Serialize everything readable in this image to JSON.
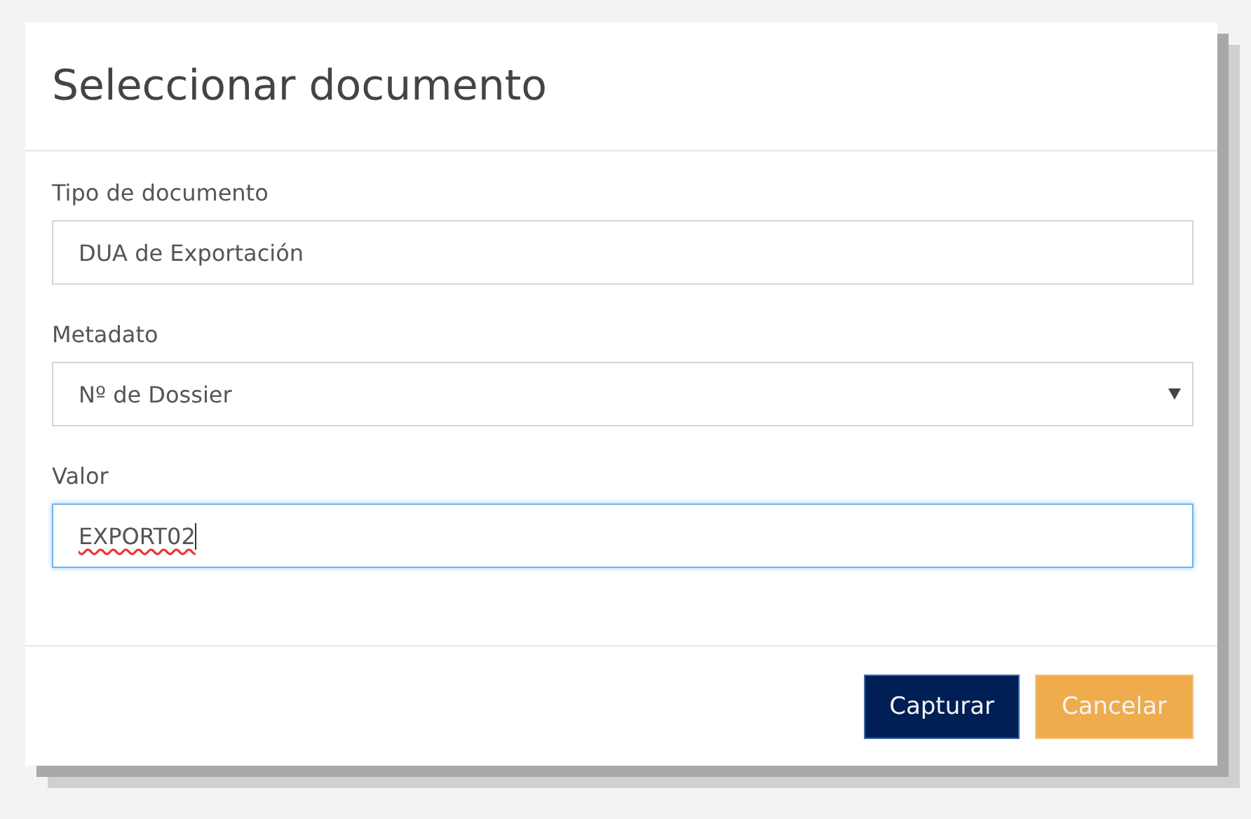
{
  "dialog": {
    "title": "Seleccionar documento"
  },
  "fields": [
    {
      "kind": "text",
      "label": "Tipo de documento",
      "value": "DUA de Exportación",
      "focused": false
    },
    {
      "kind": "select",
      "label": "Metadato",
      "value": "Nº de Dossier",
      "focused": false
    },
    {
      "kind": "text",
      "label": "Valor",
      "value": "EXPORT02",
      "focused": true
    }
  ],
  "buttons": [
    {
      "kind": "primary",
      "label": "Capturar"
    },
    {
      "kind": "warning",
      "label": "Cancelar"
    }
  ]
}
